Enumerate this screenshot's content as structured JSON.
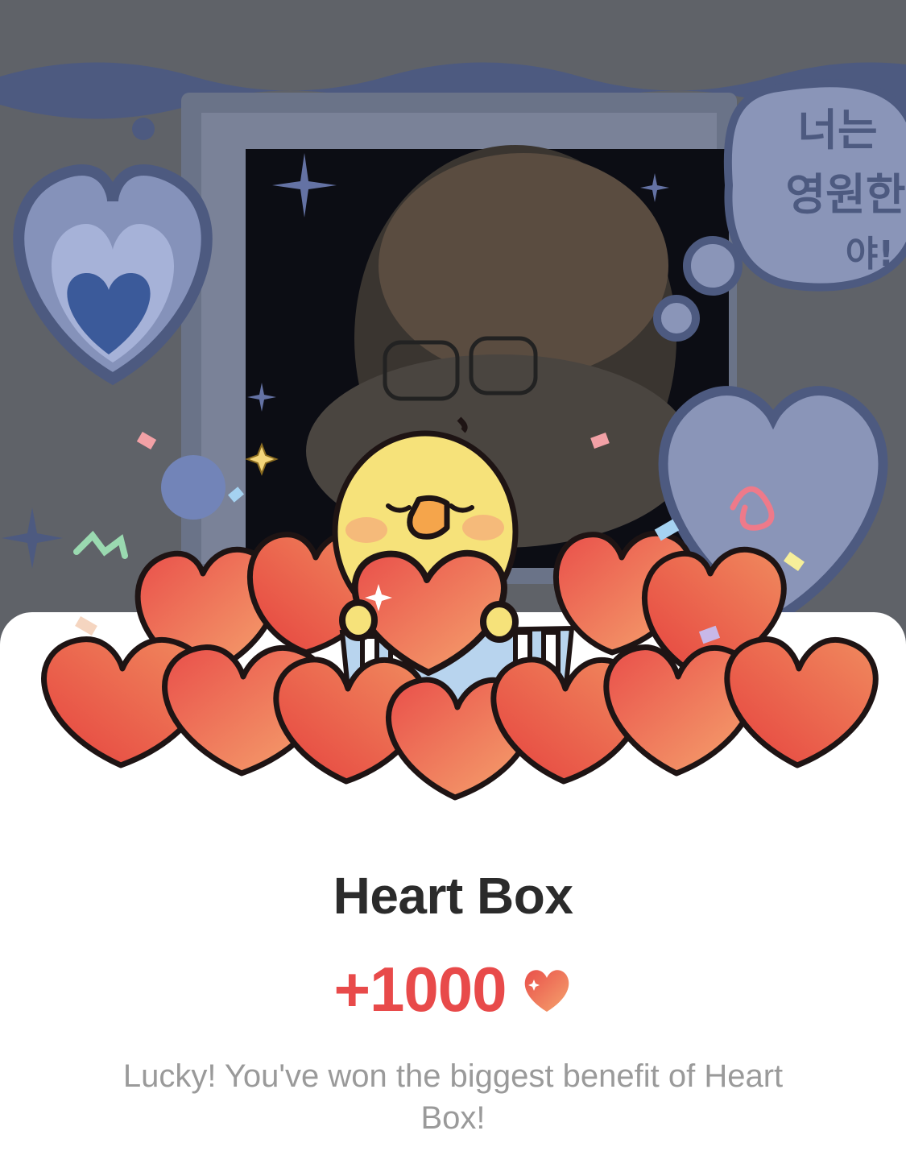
{
  "popup": {
    "title": "Heart Box",
    "reward_amount": "+1000",
    "reward_icon": "heart-icon",
    "message": "Lucky! You've won the biggest benefit of Heart Box!"
  },
  "background": {
    "banner_text": "너는 영원한 야!"
  },
  "colors": {
    "accent": "#e84a4a",
    "title": "#2b2b2b",
    "message": "#9a9a9a",
    "sheet": "#ffffff"
  }
}
